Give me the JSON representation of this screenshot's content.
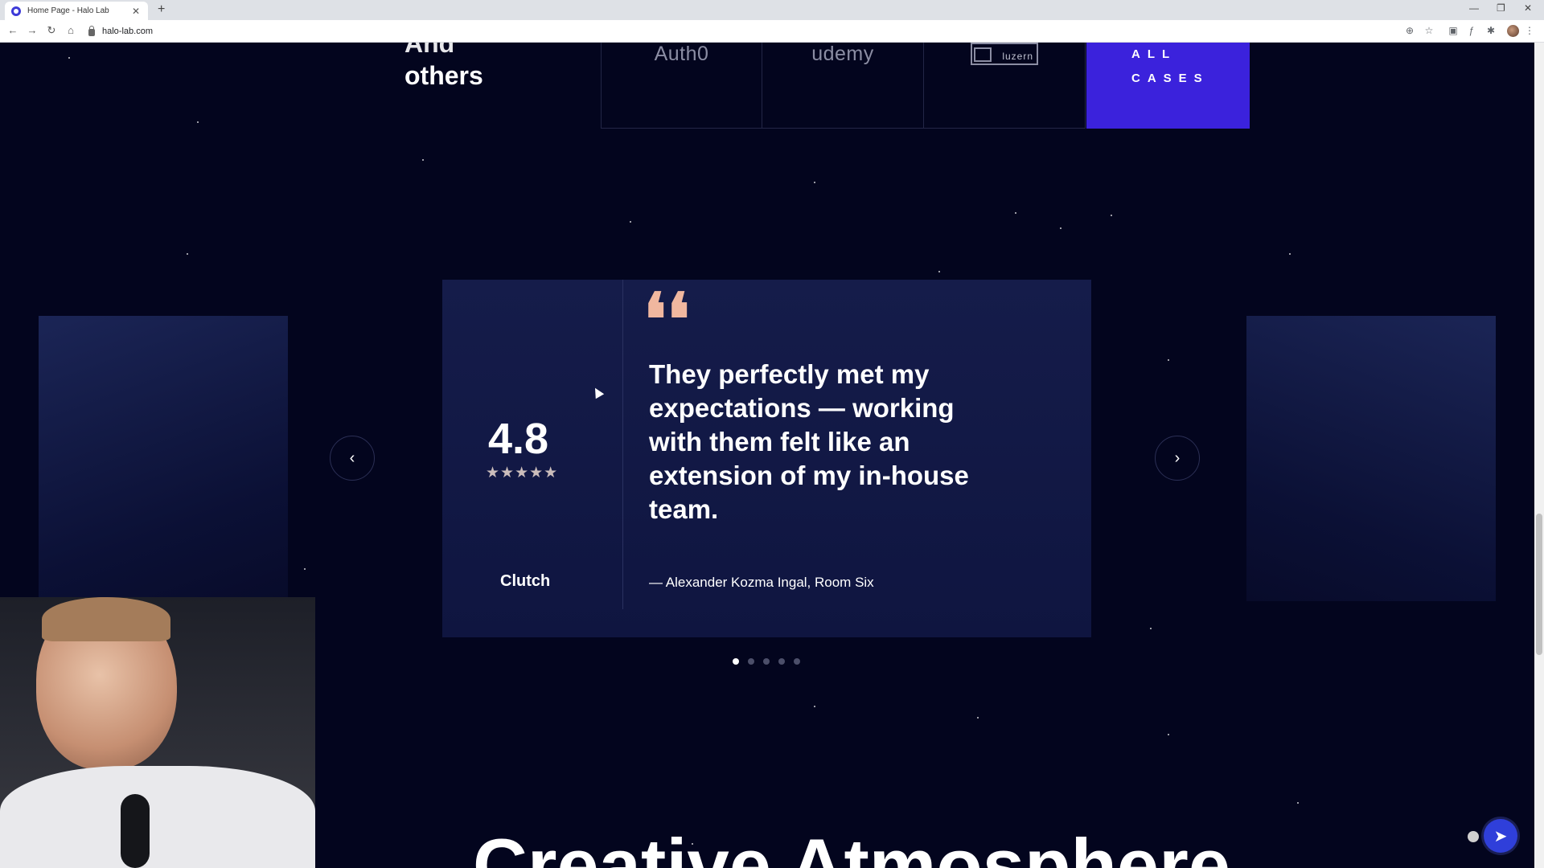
{
  "browser": {
    "tab_title": "Home Page - Halo Lab",
    "tab_close": "✕",
    "new_tab": "+",
    "url": "halo-lab.com",
    "window_controls": {
      "minimize": "—",
      "restore": "❐",
      "close": "✕"
    },
    "nav": {
      "back": "←",
      "forward": "→",
      "reload": "↻",
      "home": "⌂"
    },
    "toolbar_icons": {
      "install": "⊕",
      "bookmark": "☆",
      "extension_a": "▣",
      "extension_b": "ƒ",
      "extensions": "✱",
      "menu": "⋮"
    }
  },
  "clients": {
    "heading_top": "And",
    "heading": "others",
    "logos": [
      "Auth0",
      "udemy",
      "luzern"
    ],
    "all_cases_button": "ALL CASES"
  },
  "testimonial": {
    "rating": "4.8",
    "stars": "★★★★★",
    "rating_stars_count": 5,
    "platform": "Clutch",
    "quote_mark": "❛❛",
    "quote": "They perfectly met my expectations — working with them felt like an extension of my in-house team.",
    "author": "— Alexander Kozma Ingal, Room Six",
    "prev_arrow": "‹",
    "next_arrow": "›",
    "dots_count": 5,
    "active_dot": 1
  },
  "section_heading": "Creative Atmosphere",
  "chat_icon": "messenger-icon",
  "colors": {
    "background": "#03051e",
    "accent": "#3b22dc",
    "quote_mark": "#f0b79f"
  }
}
